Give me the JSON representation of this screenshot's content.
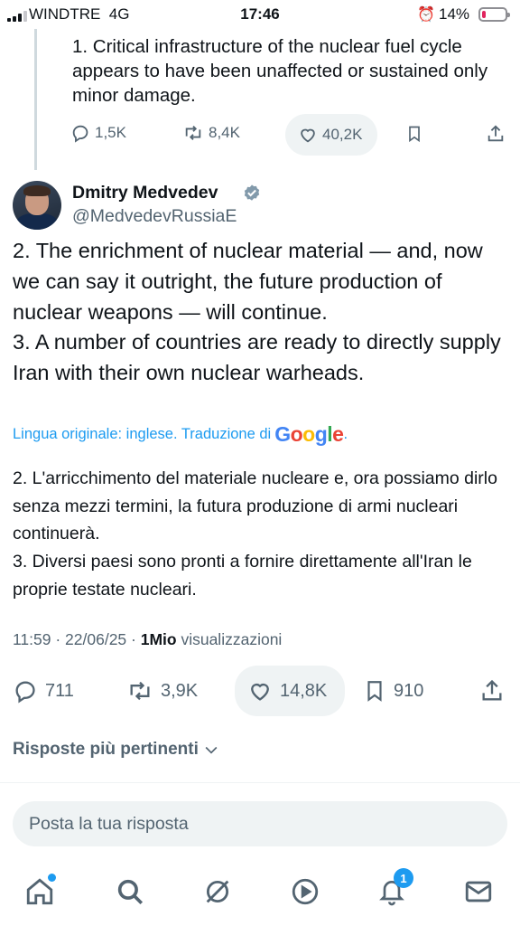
{
  "status_bar": {
    "carrier": "WINDTRE",
    "network": "4G",
    "time": "17:46",
    "battery_percent": "14%",
    "battery_level": 0.14,
    "icons": [
      "signal-icon",
      "alarm-icon",
      "battery-icon"
    ]
  },
  "previous_tweet": {
    "text": "1. Critical infrastructure of the nuclear fuel cycle appears to have been unaffected or sustained only minor damage.",
    "replies": "1,5K",
    "reposts": "8,4K",
    "likes": "40,2K"
  },
  "tweet": {
    "author_name": "Dmitry Medvedev",
    "author_handle": "@MedvedevRussiaE",
    "text_line_1": "2. The enrichment of nuclear material — and, now we can say it outright, the future production of nuclear weapons — will continue.",
    "text_line_2": "3. A number of countries are ready to directly supply Iran with their own nuclear warheads.",
    "translation_note": "Lingua originale: inglese. Traduzione di",
    "translation_brand": "Google",
    "translation_suffix": ".",
    "translated_line_1": "2. L'arricchimento del materiale nucleare e, ora possiamo dirlo senza mezzi termini, la futura produzione di armi nucleari continuerà.",
    "translated_line_2": "3. Diversi paesi sono pronti a fornire direttamente all'Iran le proprie testate nucleari.",
    "timestamp": "11:59 · 22/06/25 · ",
    "views_count": "1Mio",
    "views_label": " visualizzazioni",
    "replies": "711",
    "reposts": "3,9K",
    "likes": "14,8K",
    "bookmarks": "910"
  },
  "replies_sort": {
    "label": "Risposte più pertinenti"
  },
  "reply_input": {
    "placeholder": "Posta la tua risposta"
  },
  "bottom_nav": {
    "items": [
      "home-icon",
      "search-icon",
      "grok-icon",
      "video-icon",
      "notifications-icon",
      "messages-icon"
    ],
    "notifications_badge": "1"
  },
  "colors": {
    "text": "#0f1419",
    "secondary": "#536471",
    "accent": "#1d9bf0",
    "pill": "#eff3f4",
    "battery_low": "#e0245e"
  }
}
